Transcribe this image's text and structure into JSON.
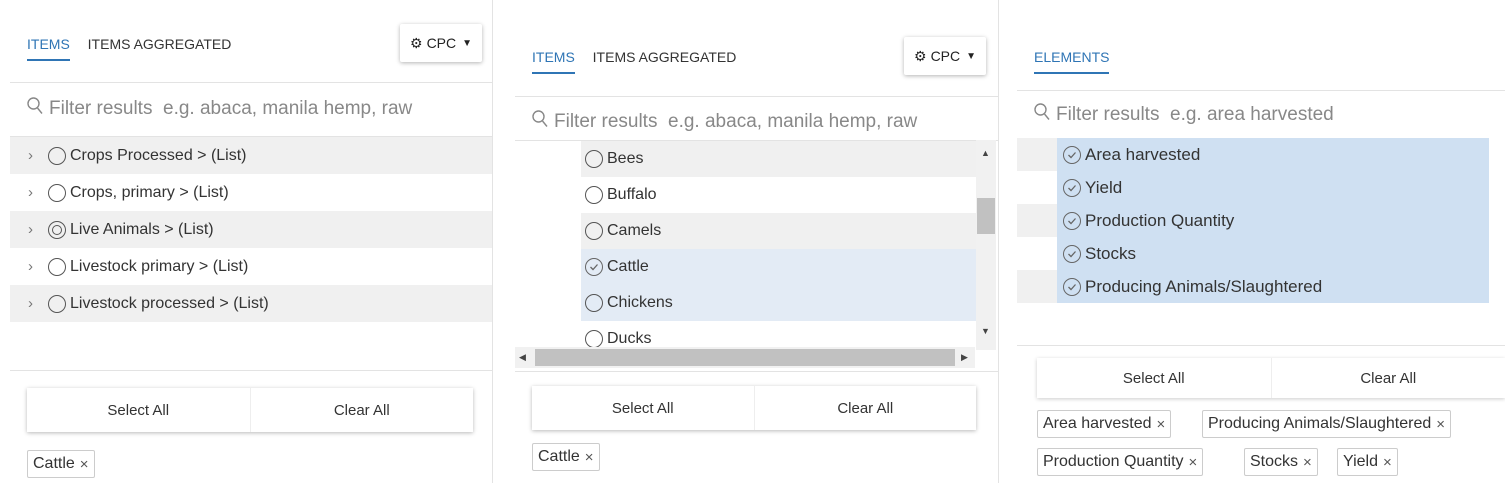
{
  "panel1": {
    "tabs": [
      "ITEMS",
      "ITEMS AGGREGATED"
    ],
    "cpc_label": "CPC",
    "filter_placeholder": "Filter results  e.g. abaca, manila hemp, raw",
    "rows": [
      {
        "label": "Crops Processed > (List)",
        "state": "empty"
      },
      {
        "label": "Crops, primary > (List)",
        "state": "empty"
      },
      {
        "label": "Live Animals > (List)",
        "state": "partial"
      },
      {
        "label": "Livestock primary > (List)",
        "state": "empty"
      },
      {
        "label": "Livestock processed > (List)",
        "state": "empty"
      }
    ],
    "select_all": "Select All",
    "clear_all": "Clear All",
    "chips": [
      "Cattle"
    ]
  },
  "panel2": {
    "tabs": [
      "ITEMS",
      "ITEMS AGGREGATED"
    ],
    "cpc_label": "CPC",
    "filter_placeholder": "Filter results  e.g. abaca, manila hemp, raw",
    "rows": [
      {
        "label": "Bees",
        "state": "empty"
      },
      {
        "label": "Buffalo",
        "state": "empty"
      },
      {
        "label": "Camels",
        "state": "empty"
      },
      {
        "label": "Cattle",
        "state": "checked"
      },
      {
        "label": "Chickens",
        "state": "empty"
      },
      {
        "label": "Ducks",
        "state": "empty"
      }
    ],
    "select_all": "Select All",
    "clear_all": "Clear All",
    "chips": [
      "Cattle"
    ]
  },
  "panel3": {
    "tabs": [
      "ELEMENTS"
    ],
    "filter_placeholder": "Filter results  e.g. area harvested",
    "rows": [
      {
        "label": "Area harvested",
        "state": "checked"
      },
      {
        "label": "Yield",
        "state": "checked"
      },
      {
        "label": "Production Quantity",
        "state": "checked"
      },
      {
        "label": "Stocks",
        "state": "checked"
      },
      {
        "label": "Producing Animals/Slaughtered",
        "state": "checked"
      }
    ],
    "select_all": "Select All",
    "clear_all": "Clear All",
    "chips": [
      "Area harvested",
      "Producing Animals/Slaughtered",
      "Production Quantity",
      "Stocks",
      "Yield"
    ]
  },
  "colors": {
    "accent": "#2f75b5",
    "selected_bg": "#cfe0f2",
    "stripe": "#f0f0f0"
  }
}
